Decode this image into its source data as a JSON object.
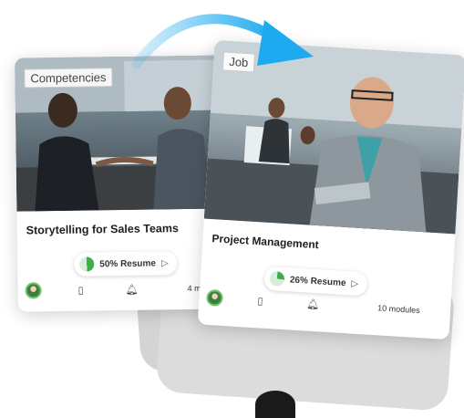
{
  "colors": {
    "accent": "#1eaaf0",
    "progress": "#3fae49",
    "card_bg": "#ffffff"
  },
  "cards": [
    {
      "tag": "Competencies",
      "title": "Storytelling for Sales Teams",
      "progress_text": "50% Resume",
      "progress_value": 0.5,
      "play_icon": "play-icon",
      "footer_icons": [
        "avatar",
        "document-icon",
        "bell-icon"
      ],
      "modules": "4 m"
    },
    {
      "tag": "Job",
      "title": "Project Management",
      "progress_text": "26% Resume",
      "progress_value": 0.26,
      "play_icon": "play-icon",
      "footer_icons": [
        "avatar",
        "document-icon",
        "bell-icon"
      ],
      "modules": "10 modules"
    }
  ]
}
